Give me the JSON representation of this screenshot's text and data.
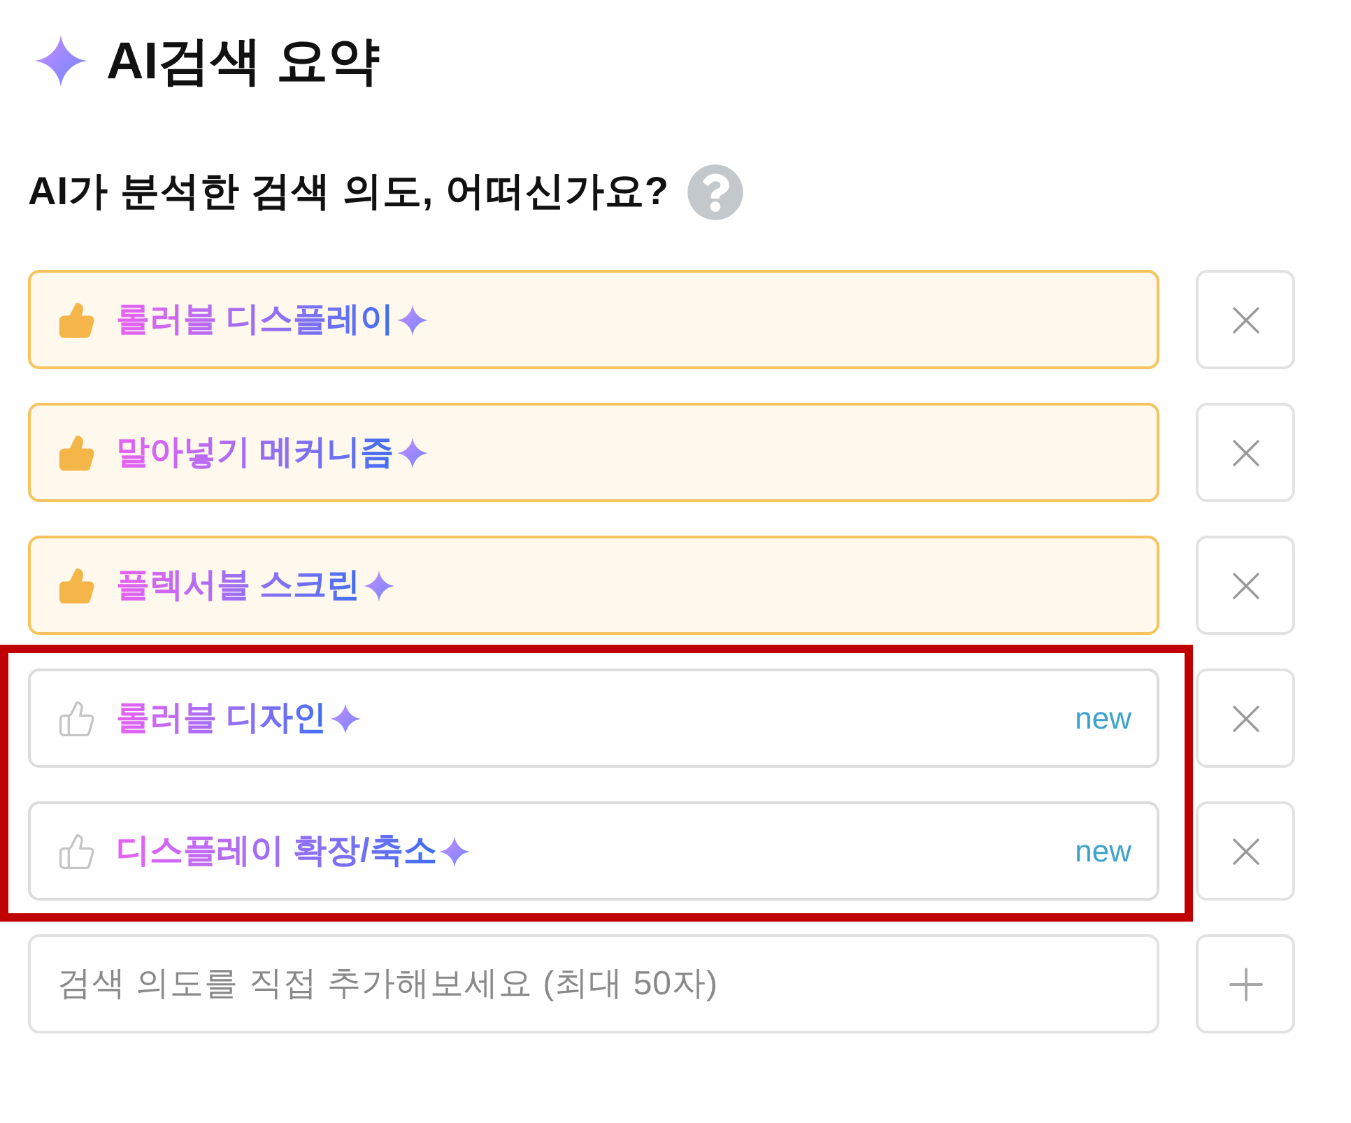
{
  "header": {
    "title": "AI검색 요약"
  },
  "question": {
    "text": "AI가 분석한 검색 의도, 어떠신가요?"
  },
  "intents": [
    {
      "label": "롤러블 디스플레이",
      "liked": true,
      "highlighted": false
    },
    {
      "label": "말아넣기 메커니즘",
      "liked": true,
      "highlighted": false
    },
    {
      "label": "플렉서블 스크린",
      "liked": true,
      "highlighted": false
    },
    {
      "label": "롤러블 디자인",
      "liked": false,
      "badge": "new",
      "highlighted": true
    },
    {
      "label": "디스플레이 확장/축소",
      "liked": false,
      "badge": "new",
      "highlighted": true
    }
  ],
  "add_field": {
    "placeholder": "검색 의도를 직접 추가해보세요 (최대 50자)"
  }
}
